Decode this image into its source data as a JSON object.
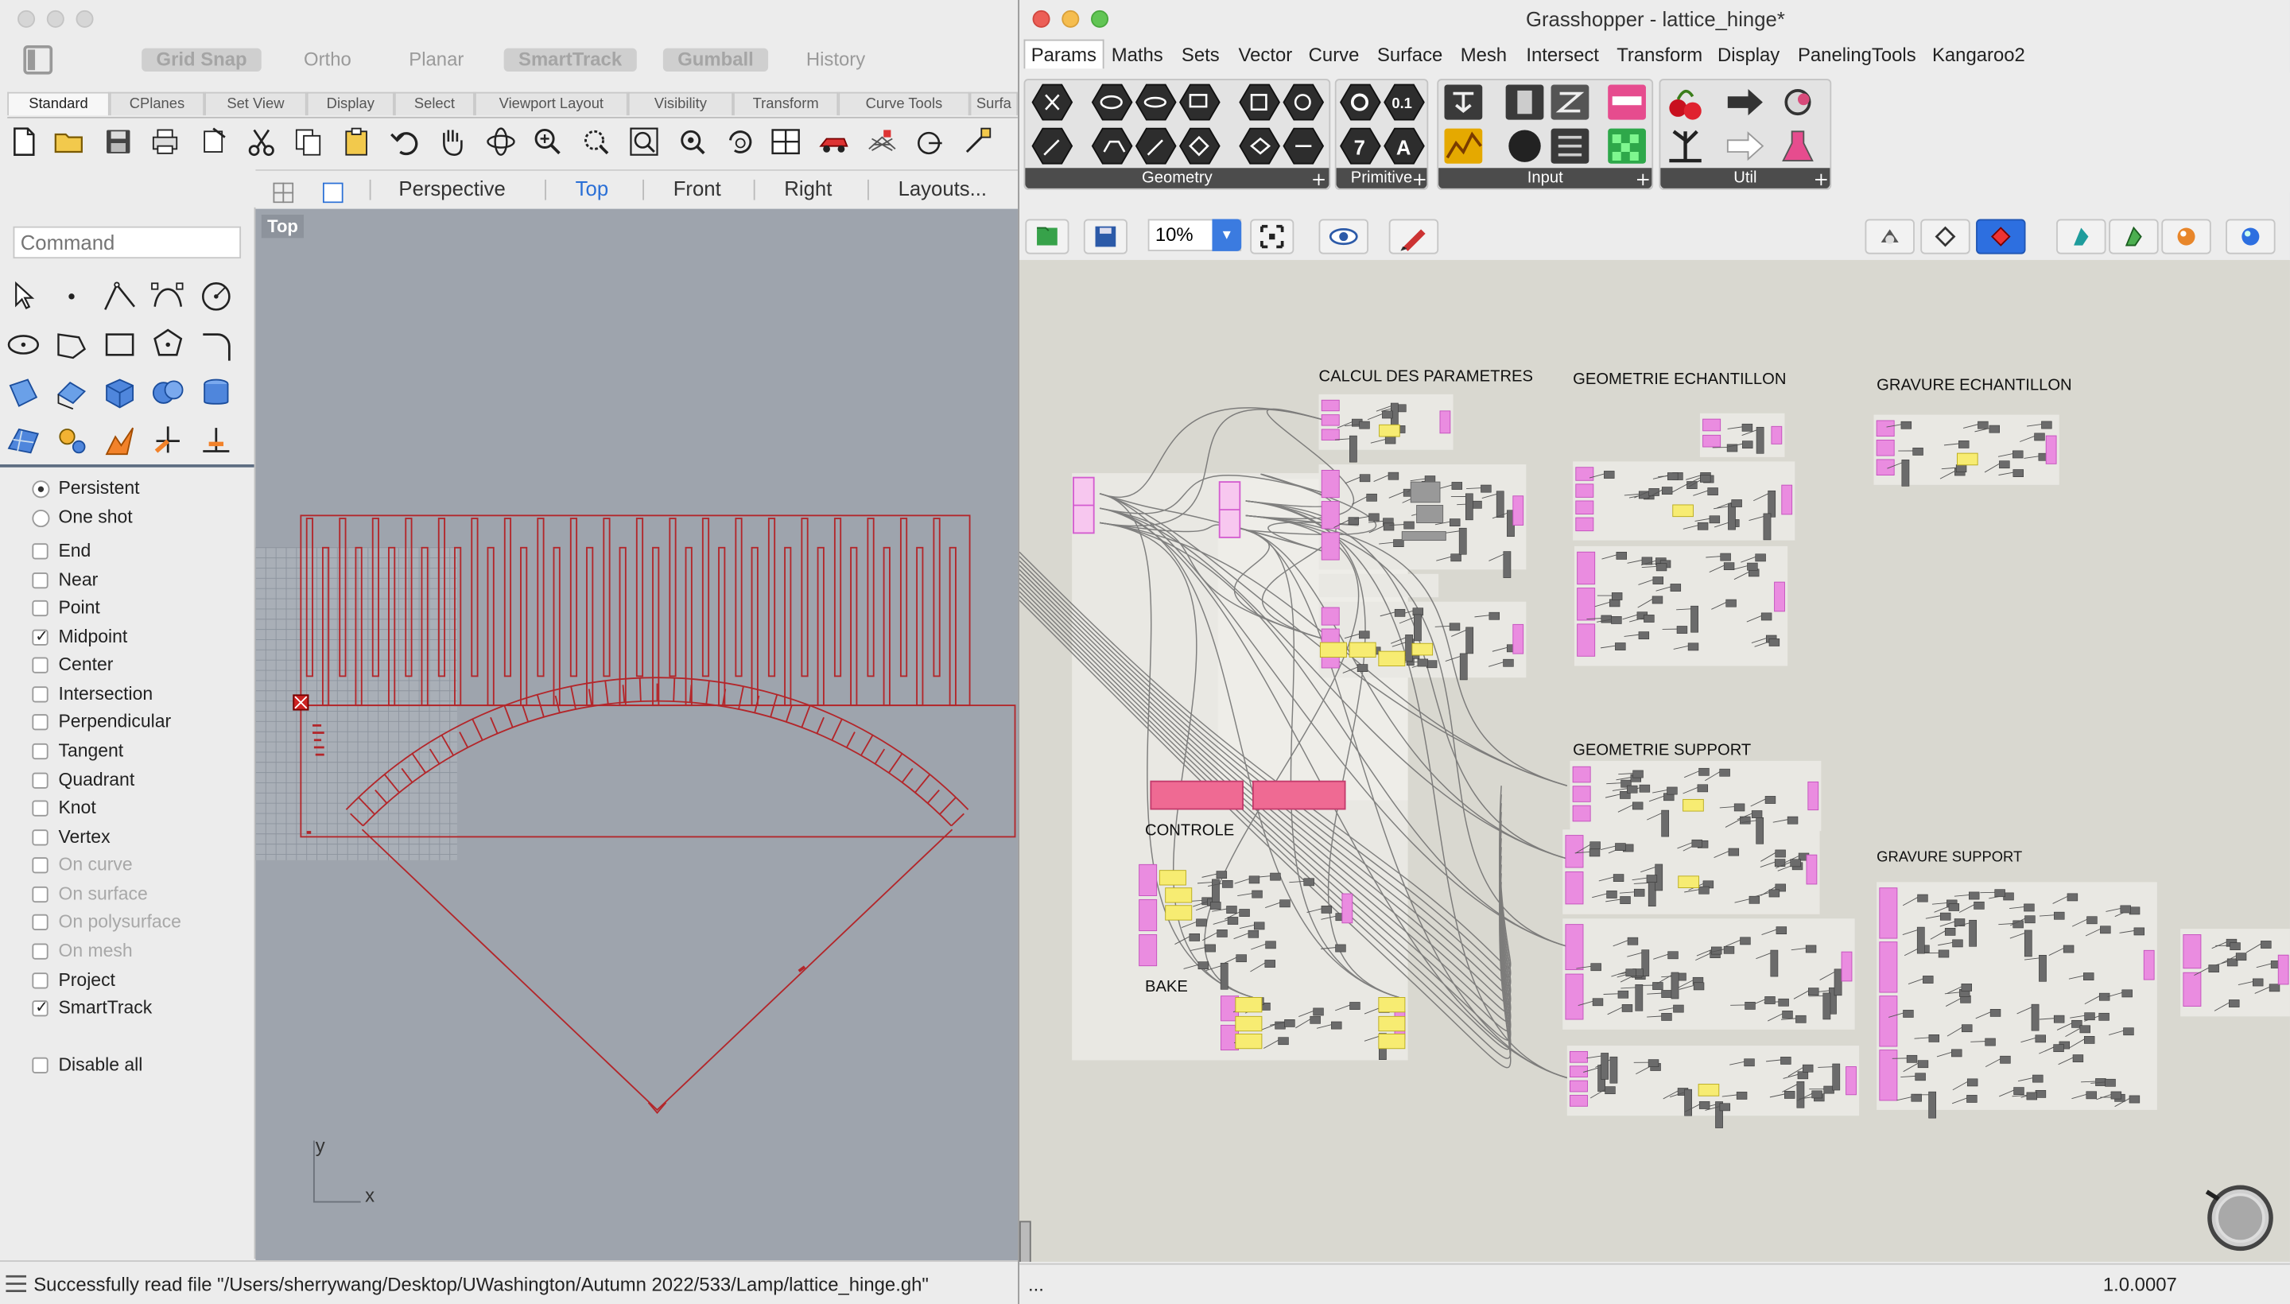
{
  "rhino": {
    "toggles": [
      {
        "label": "Grid Snap",
        "on": true
      },
      {
        "label": "Ortho",
        "on": false
      },
      {
        "label": "Planar",
        "on": false
      },
      {
        "label": "SmartTrack",
        "on": true
      },
      {
        "label": "Gumball",
        "on": true
      },
      {
        "label": "History",
        "on": false
      }
    ],
    "toolbar_tabs": [
      "Standard",
      "CPlanes",
      "Set View",
      "Display",
      "Select",
      "Viewport Layout",
      "Visibility",
      "Transform",
      "Curve Tools",
      "Surfa"
    ],
    "viewport_tabs": [
      "Perspective",
      "Top",
      "Front",
      "Right",
      "Layouts..."
    ],
    "active_viewport": "Top",
    "command_placeholder": "Command",
    "snap_modes": [
      {
        "label": "Persistent",
        "type": "radio",
        "checked": true,
        "enabled": true
      },
      {
        "label": "One shot",
        "type": "radio",
        "checked": false,
        "enabled": true
      },
      {
        "label": "End",
        "type": "check",
        "checked": false,
        "enabled": true
      },
      {
        "label": "Near",
        "type": "check",
        "checked": false,
        "enabled": true
      },
      {
        "label": "Point",
        "type": "check",
        "checked": false,
        "enabled": true
      },
      {
        "label": "Midpoint",
        "type": "check",
        "checked": true,
        "enabled": true
      },
      {
        "label": "Center",
        "type": "check",
        "checked": false,
        "enabled": true
      },
      {
        "label": "Intersection",
        "type": "check",
        "checked": false,
        "enabled": true
      },
      {
        "label": "Perpendicular",
        "type": "check",
        "checked": false,
        "enabled": true
      },
      {
        "label": "Tangent",
        "type": "check",
        "checked": false,
        "enabled": true
      },
      {
        "label": "Quadrant",
        "type": "check",
        "checked": false,
        "enabled": true
      },
      {
        "label": "Knot",
        "type": "check",
        "checked": false,
        "enabled": true
      },
      {
        "label": "Vertex",
        "type": "check",
        "checked": false,
        "enabled": true
      },
      {
        "label": "On curve",
        "type": "check",
        "checked": false,
        "enabled": false
      },
      {
        "label": "On surface",
        "type": "check",
        "checked": false,
        "enabled": false
      },
      {
        "label": "On polysurface",
        "type": "check",
        "checked": false,
        "enabled": false
      },
      {
        "label": "On mesh",
        "type": "check",
        "checked": false,
        "enabled": false
      },
      {
        "label": "Project",
        "type": "check",
        "checked": false,
        "enabled": true
      },
      {
        "label": "SmartTrack",
        "type": "check",
        "checked": true,
        "enabled": true
      },
      {
        "label": "Disable all",
        "type": "check",
        "checked": false,
        "enabled": true
      }
    ],
    "axis_x": "x",
    "axis_y": "y",
    "status_message": "Successfully read file \"/Users/sherrywang/Desktop/UWashington/Autumn 2022/533/Lamp/lattice_hinge.gh\""
  },
  "grasshopper": {
    "title": "Grasshopper - lattice_hinge*",
    "menu": [
      "Params",
      "Maths",
      "Sets",
      "Vector",
      "Curve",
      "Surface",
      "Mesh",
      "Intersect",
      "Transform",
      "Display",
      "PanelingTools",
      "Kangaroo2"
    ],
    "active_menu": "Params",
    "ribbon_groups": [
      "Geometry",
      "Primitive",
      "Input",
      "Util"
    ],
    "zoom": "10%",
    "group_labels": {
      "calcul": "CALCUL DES PARAMETRES",
      "geo_ech": "GEOMETRIE ECHANTILLON",
      "grav_ech": "GRAVURE ECHANTILLON",
      "controle": "CONTROLE",
      "bake": "BAKE",
      "geo_sup": "GEOMETRIE SUPPORT",
      "grav_sup": "GRAVURE SUPPORT"
    },
    "status_left": "...",
    "version": "1.0.0007"
  }
}
